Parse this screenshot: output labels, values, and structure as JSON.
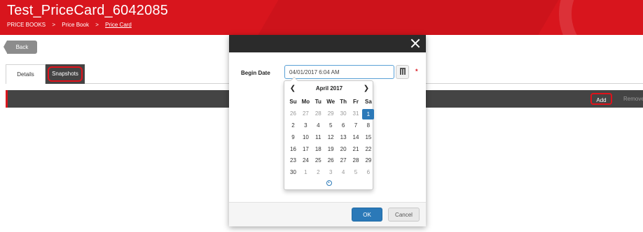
{
  "header": {
    "title": "Test_PriceCard_6042085",
    "breadcrumbs": [
      "PRICE BOOKS",
      "Price Book",
      "Price Card"
    ],
    "separator": ">"
  },
  "nav": {
    "back_label": "Back"
  },
  "tabs": [
    {
      "label": "Details",
      "active": false
    },
    {
      "label": "Snapshots",
      "active": true
    }
  ],
  "toolbar": {
    "add_label": "Add",
    "remove_label": "Remove"
  },
  "modal": {
    "begin_date_label": "Begin Date",
    "begin_date_value": "04/01/2017 6:04 AM",
    "required_marker": "*",
    "ok_label": "OK",
    "cancel_label": "Cancel"
  },
  "calendar": {
    "month_label": "April 2017",
    "prev_icon": "chevron-left-icon",
    "next_icon": "chevron-right-icon",
    "weekdays": [
      "Su",
      "Mo",
      "Tu",
      "We",
      "Th",
      "Fr",
      "Sa"
    ],
    "weeks": [
      [
        "26",
        "27",
        "28",
        "29",
        "30",
        "31",
        "1"
      ],
      [
        "2",
        "3",
        "4",
        "5",
        "6",
        "7",
        "8"
      ],
      [
        "9",
        "10",
        "11",
        "12",
        "13",
        "14",
        "15"
      ],
      [
        "16",
        "17",
        "18",
        "19",
        "20",
        "21",
        "22"
      ],
      [
        "23",
        "24",
        "25",
        "26",
        "27",
        "28",
        "29"
      ],
      [
        "30",
        "1",
        "2",
        "3",
        "4",
        "5",
        "6"
      ]
    ],
    "other_month": [
      [
        true,
        true,
        true,
        true,
        true,
        true,
        false
      ],
      [
        false,
        false,
        false,
        false,
        false,
        false,
        false
      ],
      [
        false,
        false,
        false,
        false,
        false,
        false,
        false
      ],
      [
        false,
        false,
        false,
        false,
        false,
        false,
        false
      ],
      [
        false,
        false,
        false,
        false,
        false,
        false,
        false
      ],
      [
        false,
        true,
        true,
        true,
        true,
        true,
        true
      ]
    ],
    "selected": {
      "week": 0,
      "day": 6
    }
  },
  "colors": {
    "header_red": "#d8151d",
    "dark_bar": "#444444",
    "accent_blue": "#2b79b8",
    "highlight_ring": "#e0121b"
  }
}
